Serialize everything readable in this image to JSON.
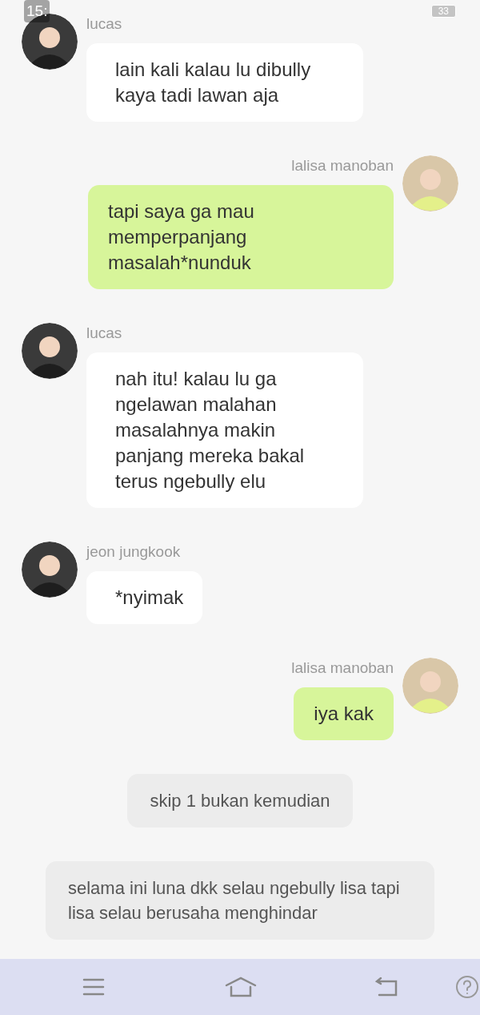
{
  "status_bar": {
    "time": "15:",
    "battery": "33"
  },
  "messages": [
    {
      "kind": "incoming",
      "sender": "lucas",
      "text": "lain kali kalau lu dibully kaya tadi lawan aja"
    },
    {
      "kind": "outgoing",
      "sender": "lalisa manoban",
      "text": "tapi saya ga mau memperpanjang masalah*nunduk"
    },
    {
      "kind": "incoming",
      "sender": "lucas",
      "text": "nah itu! kalau lu ga ngelawan malahan masalahnya makin panjang mereka bakal terus ngebully elu"
    },
    {
      "kind": "incoming",
      "sender": "jeon jungkook",
      "text": "*nyimak"
    },
    {
      "kind": "outgoing",
      "sender": "lalisa manoban",
      "text": "iya kak"
    },
    {
      "kind": "narration",
      "text": "skip 1 bukan kemudian"
    },
    {
      "kind": "narration",
      "text": "selama ini luna dkk selau ngebully lisa tapi lisa selau berusaha menghindar"
    }
  ]
}
